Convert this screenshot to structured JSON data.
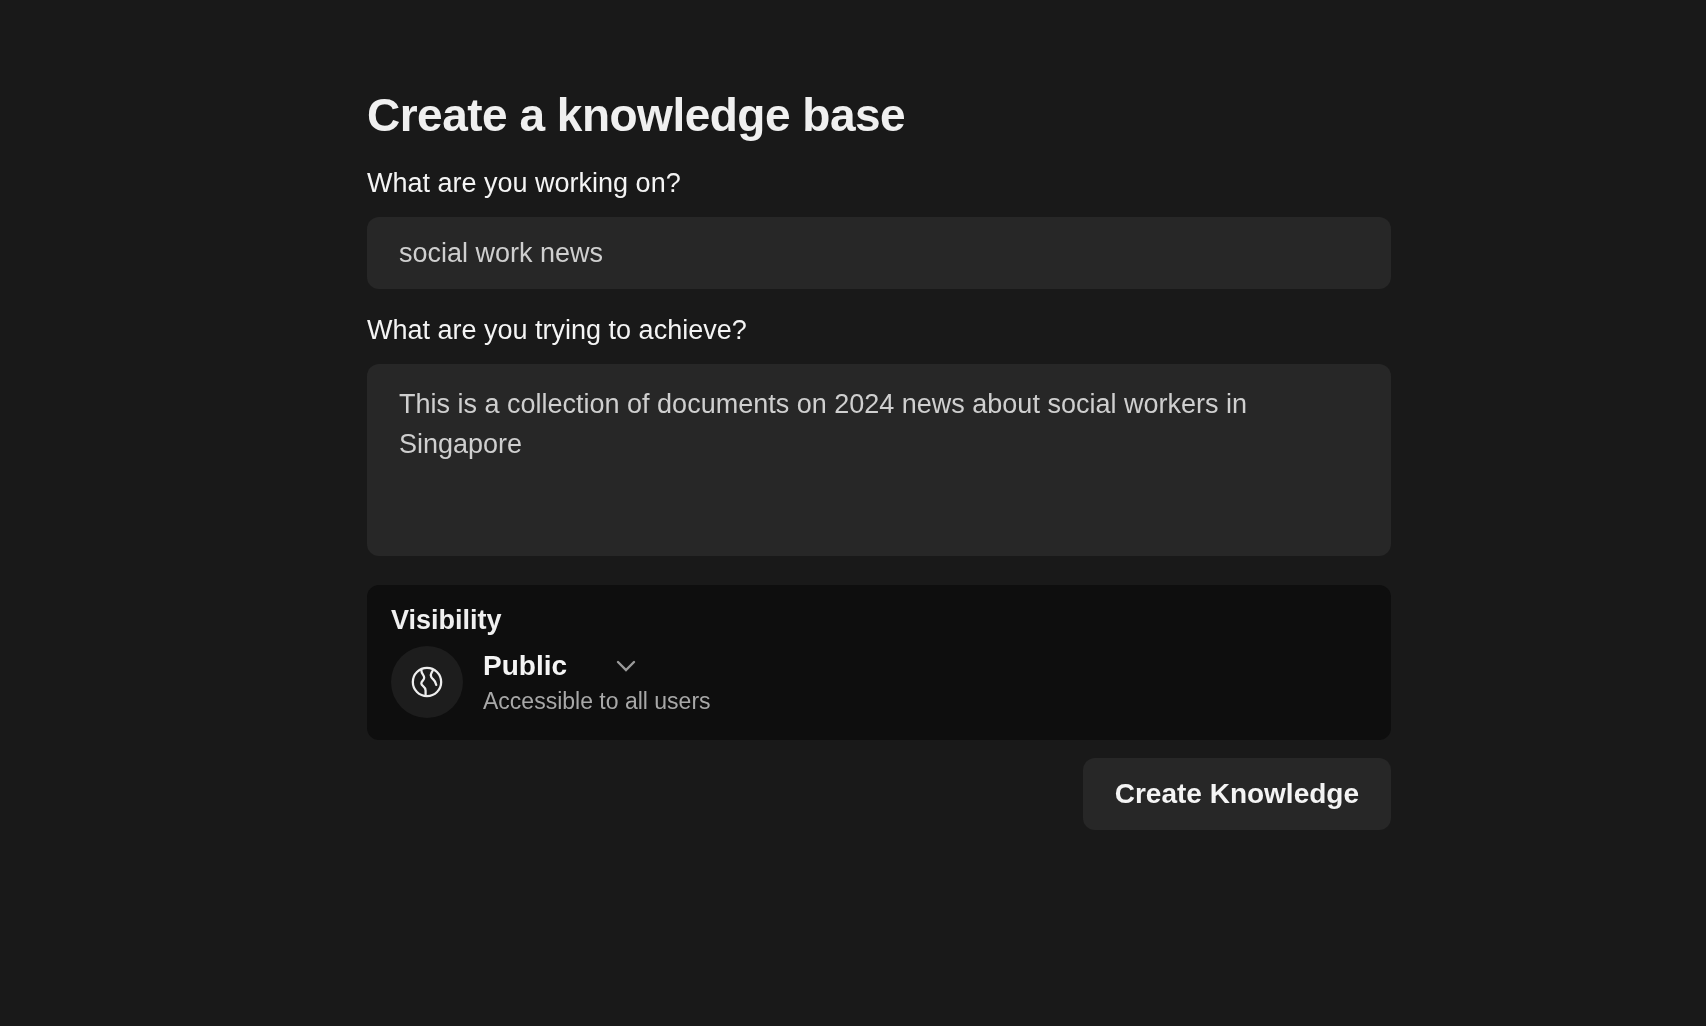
{
  "title": "Create a knowledge base",
  "fields": [
    {
      "label": "What are you working on?",
      "kind": "input",
      "value": "social work news"
    },
    {
      "label": "What are you trying to achieve?",
      "kind": "textarea",
      "value": "This is a collection of documents on 2024 news about social workers in Singapore"
    }
  ],
  "visibility": {
    "heading": "Visibility",
    "option": "Public",
    "description": "Accessible to all users"
  },
  "submit_button": "Create Knowledge"
}
